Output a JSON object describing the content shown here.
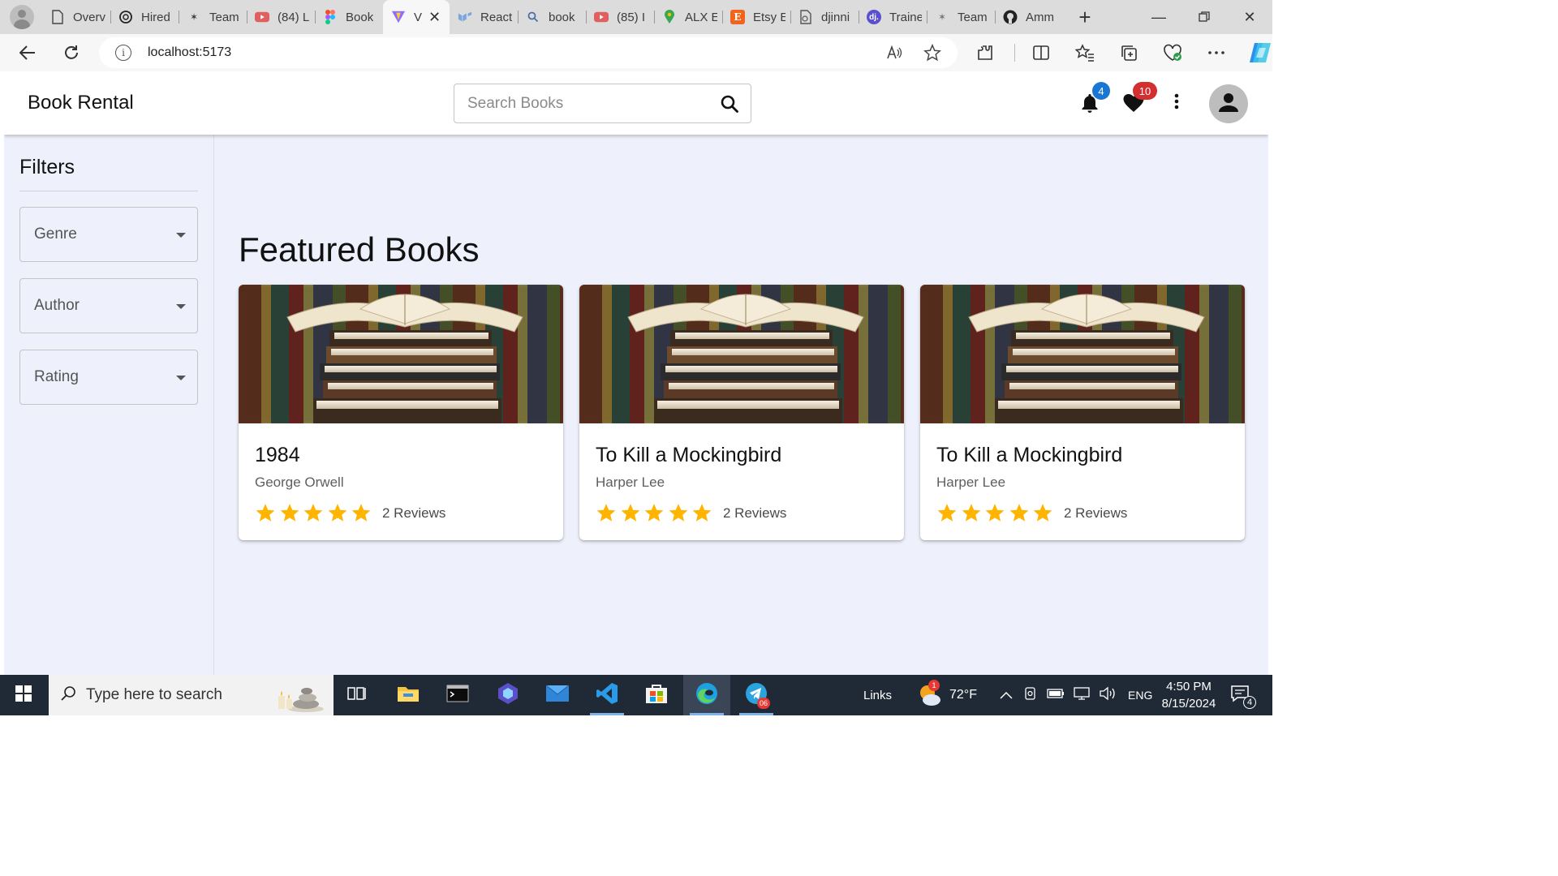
{
  "browser": {
    "tabs": [
      {
        "title": "Overv",
        "icon": "document-icon"
      },
      {
        "title": "Hired",
        "icon": "openai-icon"
      },
      {
        "title": "Team",
        "icon": "spark-icon"
      },
      {
        "title": "(84) L",
        "icon": "youtube-icon"
      },
      {
        "title": "Book",
        "icon": "figma-icon"
      },
      {
        "title": "V",
        "icon": "vite-icon",
        "active": true
      },
      {
        "title": "React",
        "icon": "mui-icon"
      },
      {
        "title": "book",
        "icon": "search-icon"
      },
      {
        "title": "(85) I",
        "icon": "youtube-icon"
      },
      {
        "title": "ALX E",
        "icon": "maps-icon"
      },
      {
        "title": "Etsy E",
        "icon": "etsy-icon"
      },
      {
        "title": "djinni",
        "icon": "file-icon"
      },
      {
        "title": "Traine",
        "icon": "dj-icon"
      },
      {
        "title": "Team",
        "icon": "spark-icon"
      },
      {
        "title": "Amm",
        "icon": "github-icon"
      }
    ],
    "address": "localhost:5173"
  },
  "app": {
    "brand": "Book Rental",
    "search_placeholder": "Search Books",
    "notifications_count": "4",
    "favorites_count": "10",
    "colors": {
      "badge_blue": "#1976d2",
      "badge_red": "#d32f2f",
      "star": "#ffb400",
      "page_bg": "#eef0fb"
    }
  },
  "sidebar": {
    "title": "Filters",
    "filters": [
      {
        "label": "Genre"
      },
      {
        "label": "Author"
      },
      {
        "label": "Rating"
      }
    ]
  },
  "main": {
    "title": "Featured Books",
    "books": [
      {
        "title": "1984",
        "author": "George Orwell",
        "rating": 5,
        "reviews": "2 Reviews"
      },
      {
        "title": "To Kill a Mockingbird",
        "author": "Harper Lee",
        "rating": 5,
        "reviews": "2 Reviews"
      },
      {
        "title": "To Kill a Mockingbird",
        "author": "Harper Lee",
        "rating": 5,
        "reviews": "2 Reviews"
      }
    ]
  },
  "taskbar": {
    "search_placeholder": "Type here to search",
    "links_label": "Links",
    "weather": "72°F",
    "weather_badge": "1",
    "language": "ENG",
    "time": "4:50 PM",
    "date": "8/15/2024",
    "notifications_count": "4",
    "telegram_badge": "06"
  }
}
